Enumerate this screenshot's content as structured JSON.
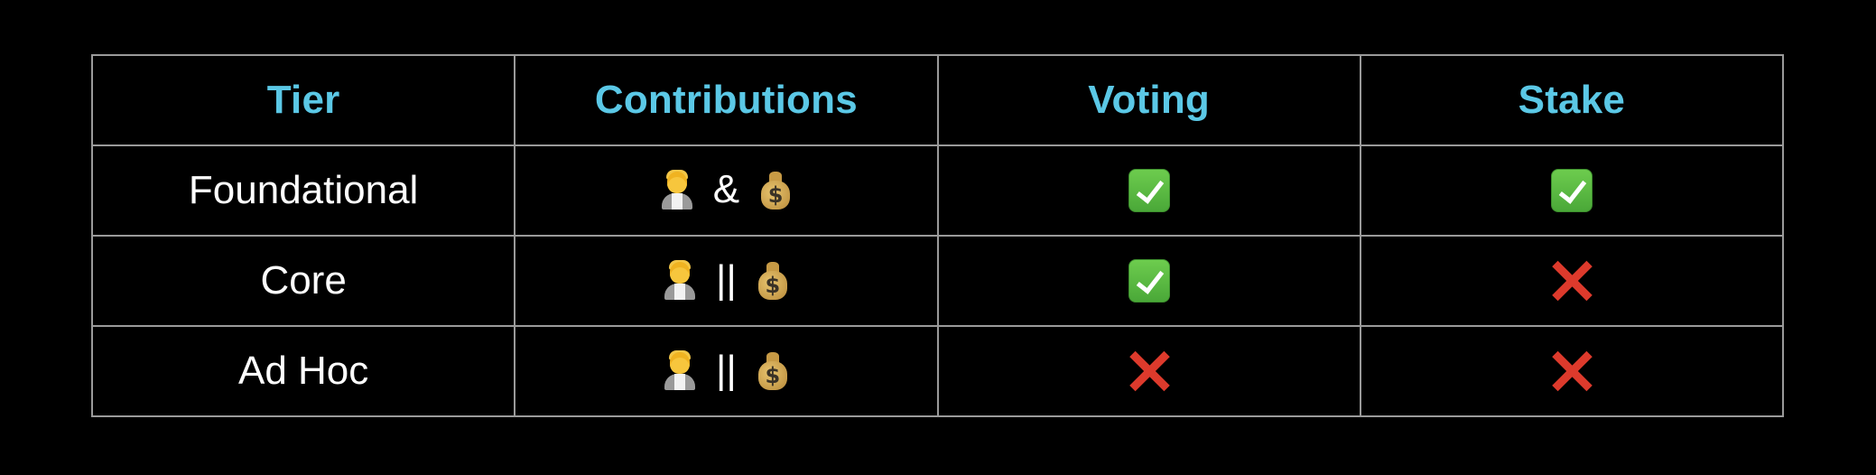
{
  "table": {
    "headers": [
      "Tier",
      "Contributions",
      "Voting",
      "Stake"
    ],
    "header_color": "#5bc8e6",
    "rows": [
      {
        "tier": "Foundational",
        "contributions": {
          "left_icon": "office-worker-icon",
          "operator": "&",
          "right_icon": "money-bag-icon"
        },
        "voting": {
          "value": true,
          "icon": "check-mark-icon"
        },
        "stake": {
          "value": true,
          "icon": "check-mark-icon"
        }
      },
      {
        "tier": "Core",
        "contributions": {
          "left_icon": "office-worker-icon",
          "operator": "||",
          "right_icon": "money-bag-icon"
        },
        "voting": {
          "value": true,
          "icon": "check-mark-icon"
        },
        "stake": {
          "value": false,
          "icon": "cross-mark-icon"
        }
      },
      {
        "tier": "Ad Hoc",
        "contributions": {
          "left_icon": "office-worker-icon",
          "operator": "||",
          "right_icon": "money-bag-icon"
        },
        "voting": {
          "value": false,
          "icon": "cross-mark-icon"
        },
        "stake": {
          "value": false,
          "icon": "cross-mark-icon"
        }
      }
    ],
    "colors": {
      "check": "#5cbf44",
      "cross": "#dd3a2c",
      "border": "#9a9a9a",
      "background": "#000000"
    }
  }
}
